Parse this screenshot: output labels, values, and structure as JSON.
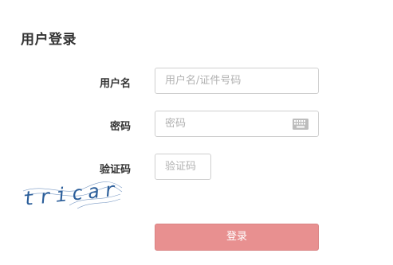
{
  "title": "用户登录",
  "form": {
    "username_label": "用户名",
    "username_placeholder": "用户名/证件号码",
    "password_label": "密码",
    "password_placeholder": "密码",
    "captcha_label": "验证码",
    "captcha_placeholder": "验证码",
    "captcha_text": "tricar",
    "submit_label": "登录"
  },
  "icons": {
    "keyboard": "keyboard-icon"
  },
  "colors": {
    "primary_button": "#e89090",
    "captcha_ink": "#2b5e9a"
  }
}
